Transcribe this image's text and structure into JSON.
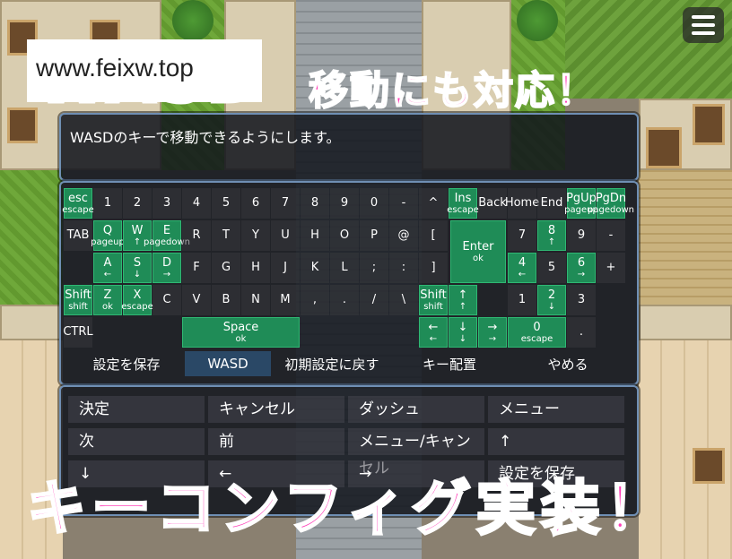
{
  "watermark": {
    "url": "www.feixw.top",
    "wasd": "WASD"
  },
  "headline": "移動にも対応！",
  "bottom_banner": "キーコンフィグ実装！",
  "help": "WASDのキーで移動できるようにします。",
  "menu_icon": "hamburger-icon",
  "keyboard": {
    "row1": [
      {
        "main": "esc",
        "sub": "escape",
        "on": true
      },
      {
        "main": "1",
        "sub": "",
        "on": false
      },
      {
        "main": "2",
        "sub": "",
        "on": false
      },
      {
        "main": "3",
        "sub": "",
        "on": false
      },
      {
        "main": "4",
        "sub": "",
        "on": false
      },
      {
        "main": "5",
        "sub": "",
        "on": false
      },
      {
        "main": "6",
        "sub": "",
        "on": false
      },
      {
        "main": "7",
        "sub": "",
        "on": false
      },
      {
        "main": "8",
        "sub": "",
        "on": false
      },
      {
        "main": "9",
        "sub": "",
        "on": false
      },
      {
        "main": "0",
        "sub": "",
        "on": false
      },
      {
        "main": "-",
        "sub": "",
        "on": false
      },
      {
        "main": "^",
        "sub": "",
        "on": false
      },
      {
        "main": "Ins",
        "sub": "escape",
        "on": true
      },
      {
        "main": "Back",
        "sub": "",
        "on": false
      },
      {
        "main": "Home",
        "sub": "",
        "on": false
      },
      {
        "main": "End",
        "sub": "",
        "on": false
      },
      {
        "main": "PgUp",
        "sub": "pageup",
        "on": true
      },
      {
        "main": "PgDn",
        "sub": "pagedown",
        "on": true
      }
    ],
    "row2": [
      {
        "main": "TAB",
        "sub": "",
        "on": false
      },
      {
        "main": "Q",
        "sub": "pageup",
        "on": true
      },
      {
        "main": "W",
        "sub": "↑",
        "on": true
      },
      {
        "main": "E",
        "sub": "pagedown",
        "on": true
      },
      {
        "main": "R",
        "sub": "",
        "on": false
      },
      {
        "main": "T",
        "sub": "",
        "on": false
      },
      {
        "main": "Y",
        "sub": "",
        "on": false
      },
      {
        "main": "U",
        "sub": "",
        "on": false
      },
      {
        "main": "H",
        "sub": "",
        "on": false
      },
      {
        "main": "O",
        "sub": "",
        "on": false
      },
      {
        "main": "P",
        "sub": "",
        "on": false
      },
      {
        "main": "@",
        "sub": "",
        "on": false
      },
      {
        "main": "[",
        "sub": "",
        "on": false
      },
      {
        "main": "7",
        "sub": "",
        "on": false
      },
      {
        "main": "8",
        "sub": "↑",
        "on": true
      },
      {
        "main": "9",
        "sub": "",
        "on": false
      },
      {
        "main": "-",
        "sub": "",
        "on": false
      }
    ],
    "row3": [
      {
        "main": "A",
        "sub": "←",
        "on": true
      },
      {
        "main": "S",
        "sub": "↓",
        "on": true
      },
      {
        "main": "D",
        "sub": "→",
        "on": true
      },
      {
        "main": "F",
        "sub": "",
        "on": false
      },
      {
        "main": "G",
        "sub": "",
        "on": false
      },
      {
        "main": "H",
        "sub": "",
        "on": false
      },
      {
        "main": "J",
        "sub": "",
        "on": false
      },
      {
        "main": "K",
        "sub": "",
        "on": false
      },
      {
        "main": "L",
        "sub": "",
        "on": false
      },
      {
        "main": ";",
        "sub": "",
        "on": false
      },
      {
        "main": ":",
        "sub": "",
        "on": false
      },
      {
        "main": "]",
        "sub": "",
        "on": false
      },
      {
        "main": "4",
        "sub": "←",
        "on": true
      },
      {
        "main": "5",
        "sub": "",
        "on": false
      },
      {
        "main": "6",
        "sub": "→",
        "on": true
      },
      {
        "main": "+",
        "sub": "",
        "on": false
      }
    ],
    "enter": {
      "main": "Enter",
      "sub": "ok"
    },
    "row4": [
      {
        "main": "Shift",
        "sub": "shift",
        "on": true
      },
      {
        "main": "Z",
        "sub": "ok",
        "on": true
      },
      {
        "main": "X",
        "sub": "escape",
        "on": true
      },
      {
        "main": "C",
        "sub": "",
        "on": false
      },
      {
        "main": "V",
        "sub": "",
        "on": false
      },
      {
        "main": "B",
        "sub": "",
        "on": false
      },
      {
        "main": "N",
        "sub": "",
        "on": false
      },
      {
        "main": "M",
        "sub": "",
        "on": false
      },
      {
        "main": ",",
        "sub": "",
        "on": false
      },
      {
        "main": ".",
        "sub": "",
        "on": false
      },
      {
        "main": "/",
        "sub": "",
        "on": false
      },
      {
        "main": "\\",
        "sub": "",
        "on": false
      },
      {
        "main": "Shift",
        "sub": "shift",
        "on": true
      },
      {
        "main": "↑",
        "sub": "↑",
        "on": true
      },
      {
        "main": "1",
        "sub": "",
        "on": false
      },
      {
        "main": "2",
        "sub": "↓",
        "on": true
      },
      {
        "main": "3",
        "sub": "",
        "on": false
      }
    ],
    "row5": {
      "ctrl": "CTRL",
      "space": {
        "main": "Space",
        "sub": "ok"
      },
      "left": {
        "main": "←",
        "sub": "←"
      },
      "down": {
        "main": "↓",
        "sub": "↓"
      },
      "right": {
        "main": "→",
        "sub": "→"
      },
      "zero": {
        "main": "0",
        "sub": "escape"
      },
      "dot": "."
    }
  },
  "commands": [
    {
      "label": "設定を保存",
      "selected": false
    },
    {
      "label": "WASD",
      "selected": true
    },
    {
      "label": "初期設定に戻す",
      "selected": false
    },
    {
      "label": "キー配置",
      "selected": false
    },
    {
      "label": "やめる",
      "selected": false
    }
  ],
  "action_grid": [
    [
      "決定",
      "キャンセル",
      "ダッシュ",
      "メニュー"
    ],
    [
      "次",
      "前",
      "メニュー/キャンセル",
      "↑"
    ],
    [
      "↓",
      "←",
      "→",
      "設定を保存"
    ]
  ]
}
